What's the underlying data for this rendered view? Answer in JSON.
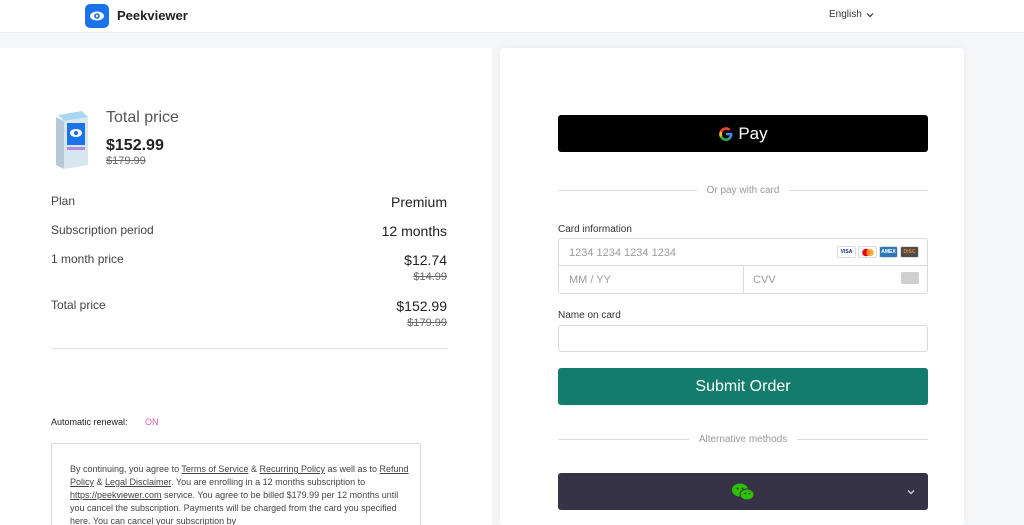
{
  "header": {
    "brand": "Peekviewer",
    "language": "English",
    "logo_icon": "eye-icon"
  },
  "summary": {
    "title": "Total price",
    "price": "$152.99",
    "old_price": "$179.99",
    "rows": [
      {
        "label": "Plan",
        "value": "Premium",
        "old_value": ""
      },
      {
        "label": "Subscription period",
        "value": "12 months",
        "old_value": ""
      },
      {
        "label": "1 month price",
        "value": "$12.74",
        "old_value": "$14.99"
      },
      {
        "label": "Total price",
        "value": "$152.99",
        "old_value": "$179.99"
      }
    ],
    "renewal_label": "Automatic renewal:",
    "renewal_value": "ON"
  },
  "terms": {
    "p1": "By continuing, you agree to ",
    "terms_link": "Terms of Service",
    "amp1": " & ",
    "recurring_link": "Recurring Policy",
    "p2": " as well as to ",
    "refund_link": "Refund Policy",
    "amp2": " & ",
    "legal_link": "Legal Disclaimer",
    "p3": ". You are enrolling in a 12 months subscription to ",
    "site_link": "https://peekviewer.com",
    "p4": " service. You agree to be billed $179.99 per 12 months until you cancel the subscription. Payments will be charged from the card you specified here. You can cancel your subscription by"
  },
  "payment": {
    "gpay_label": "Pay",
    "or_card": "Or pay with card",
    "card_info_label": "Card information",
    "card_number_placeholder": "1234 1234 1234 1234",
    "expiry_placeholder": "MM / YY",
    "cvv_placeholder": "CVV",
    "card_brands": [
      "VISA",
      "MC",
      "AMEX",
      "DISC"
    ],
    "name_label": "Name on card",
    "name_value": "",
    "submit_label": "Submit Order",
    "alternative_label": "Alternative methods",
    "alt_method_icon": "wechat-icon"
  },
  "colors": {
    "accent": "#137c6c",
    "brand": "#1a73e8",
    "renewal_on": "#e05bb5",
    "alt_button": "#363347"
  }
}
